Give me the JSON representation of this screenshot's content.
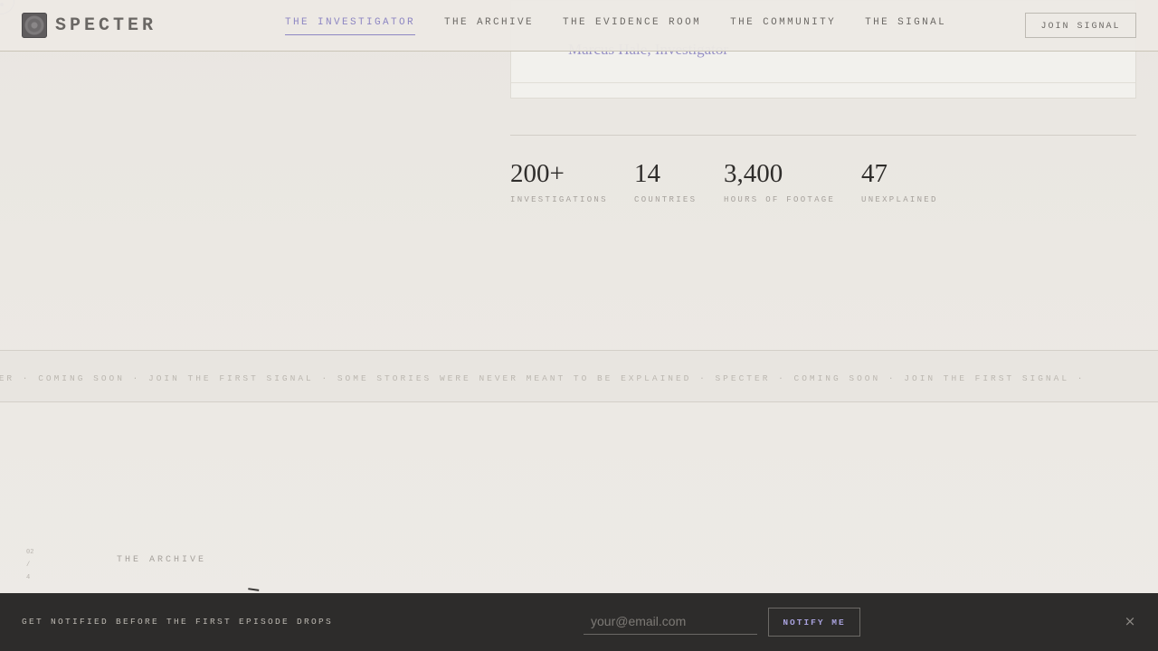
{
  "brand": {
    "name": "SPECTER",
    "icon": "specter-logo-icon"
  },
  "nav": {
    "items": [
      {
        "label": "THE INVESTIGATOR",
        "active": true
      },
      {
        "label": "THE ARCHIVE",
        "active": false
      },
      {
        "label": "THE EVIDENCE ROOM",
        "active": false
      },
      {
        "label": "THE COMMUNITY",
        "active": false
      },
      {
        "label": "THE SIGNAL",
        "active": false
      }
    ],
    "cta_label": "JOIN SIGNAL"
  },
  "quote": {
    "attribution": "Marcus Hale, Investigator"
  },
  "stats": [
    {
      "value": "200+",
      "label": "INVESTIGATIONS"
    },
    {
      "value": "14",
      "label": "COUNTRIES"
    },
    {
      "value": "3,400",
      "label": "HOURS OF FOOTAGE"
    },
    {
      "value": "47",
      "label": "UNEXPLAINED"
    }
  ],
  "marquee": {
    "text": "TER · COMING SOON · JOIN THE FIRST SIGNAL · SOME STORIES WERE NEVER MEANT TO BE EXPLAINED · SPECTER · COMING SOON · JOIN THE FIRST SIGNAL ·"
  },
  "archive": {
    "section_label": "THE ARCHIVE",
    "index": "02 / 4"
  },
  "notify": {
    "text": "GET NOTIFIED BEFORE THE FIRST EPISODE DROPS",
    "email_placeholder": "your@email.com",
    "button_label": "NOTIFY ME",
    "close_label": "×"
  },
  "colors": {
    "accent": "#8e87c3",
    "background": "#ebe8e3",
    "bar": "#2d2c2b"
  }
}
